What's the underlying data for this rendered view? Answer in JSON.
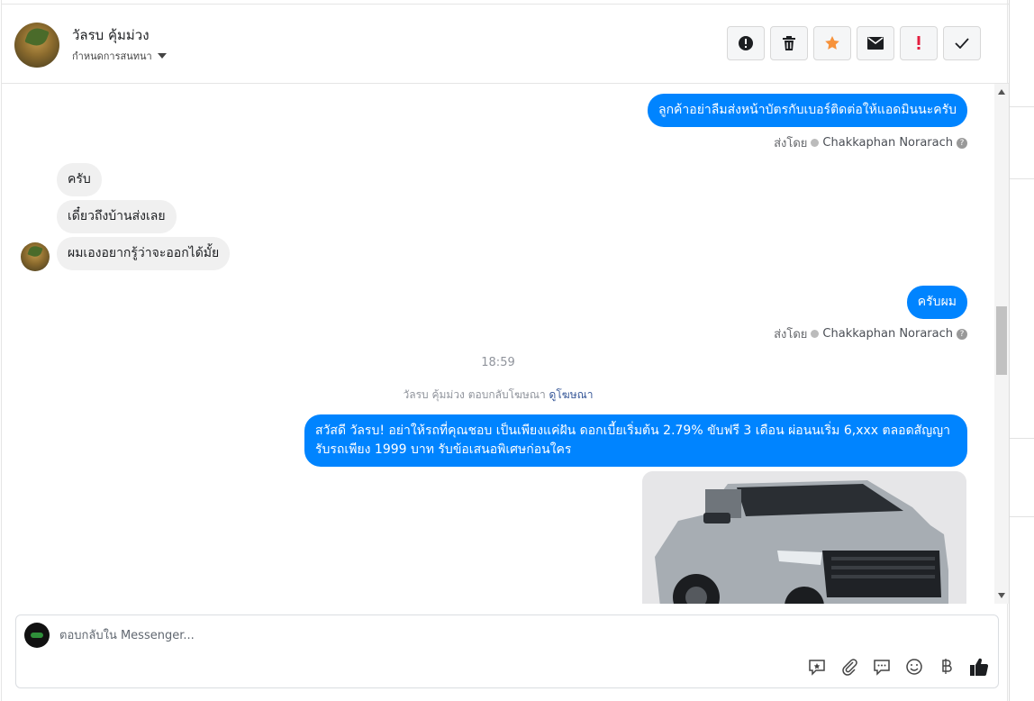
{
  "header": {
    "name": "วัลรบ คุ้มม่วง",
    "assign_label": "กำหนดการสนทนา"
  },
  "actions": [
    {
      "icon": "exclamation-circle-icon"
    },
    {
      "icon": "trash-icon"
    },
    {
      "icon": "star-icon",
      "color": "#f7923b"
    },
    {
      "icon": "envelope-icon"
    },
    {
      "icon": "exclamation-red-icon",
      "color": "#e41e3f"
    },
    {
      "icon": "checkmark-icon"
    }
  ],
  "messages": {
    "out1": "ลูกค้าอย่าลืมส่งหน้าบัตรกับเบอร์ติดต่อให้แอดมินนะครับ",
    "sentby_label": "ส่งโดย",
    "agent": "Chakkaphan Norarach",
    "in1": "ครับ",
    "in2": "เดี๋ยวถึงบ้านส่งเลย",
    "in3": "ผมเองอยากรู้ว่าจะออกได้มั้ย",
    "out2": "ครับผม",
    "time": "18:59",
    "ad_reply": "วัลรบ คุ้มม่วง ตอบกลับโฆษณา",
    "ad_link": "ดูโฆษณา",
    "out3": "สวัสดี วัลรบ! อย่าให้รถที่คุณชอบ เป็นเพียงแค่ฝัน ดอกเบี้ยเริ่มต้น 2.79% ขับฟรี 3 เดือน ผ่อนนเริ่ม 6,xxx ตลอดสัญญา รับรถเพียง 1999 บาท รับข้อเสนอพิเศษก่อนใคร"
  },
  "composer": {
    "placeholder": "ตอบกลับใน Messenger...",
    "value": ""
  },
  "tools": [
    "saved-reply-icon",
    "attachment-icon",
    "chat-bubble-icon",
    "emoji-icon",
    "baht-icon",
    "thumbs-up-icon"
  ],
  "colors": {
    "accent": "#0084ff",
    "incoming_bg": "#f0f0f0"
  }
}
